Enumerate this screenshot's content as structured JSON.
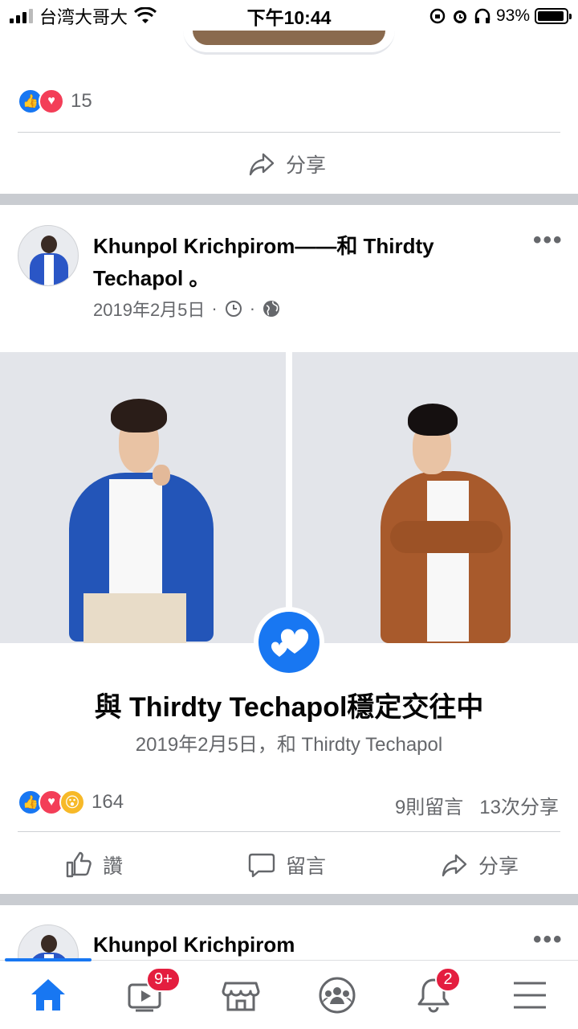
{
  "status_bar": {
    "carrier": "台湾大哥大",
    "time": "下午10:44",
    "battery": "93%",
    "battery_level": 0.93
  },
  "prev_post": {
    "reaction_count": "15",
    "share_label": "分享"
  },
  "post": {
    "author_line1": "Khunpol Krichpirom——和 Thirdty",
    "author_line2": "Techapol 。",
    "date": "2019年2月5日",
    "meta_sep": "·",
    "event_title": "與 Thirdty Techapol穩定交往中",
    "event_subtitle": "2019年2月5日，和 Thirdty Techapol",
    "reaction_count": "164",
    "comments": "9則留言",
    "shares": "13次分享",
    "actions": {
      "like": "讚",
      "comment": "留言",
      "share": "分享"
    },
    "more": "•••"
  },
  "next_post": {
    "author": "Khunpol Krichpirom",
    "more": "•••"
  },
  "nav": {
    "video_badge": "9+",
    "notif_badge": "2"
  },
  "colors": {
    "accent": "#1877f2",
    "badge": "#e41e3f",
    "muted": "#65676b"
  }
}
